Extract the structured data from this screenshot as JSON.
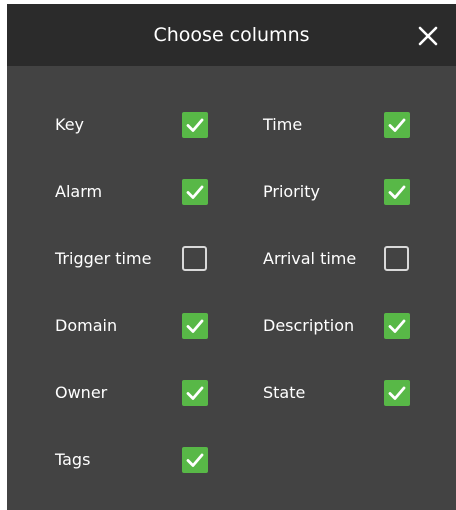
{
  "dialog": {
    "title": "Choose columns",
    "close_icon": "close-icon",
    "colors": {
      "background": "#434343",
      "titlebar": "#2b2b2b",
      "checked": "#58b847",
      "text": "#ffffff"
    }
  },
  "columns": [
    {
      "label": "Key",
      "checked": true
    },
    {
      "label": "Time",
      "checked": true
    },
    {
      "label": "Alarm",
      "checked": true
    },
    {
      "label": "Priority",
      "checked": true
    },
    {
      "label": "Trigger time",
      "checked": false
    },
    {
      "label": "Arrival time",
      "checked": false
    },
    {
      "label": "Domain",
      "checked": true
    },
    {
      "label": "Description",
      "checked": true
    },
    {
      "label": "Owner",
      "checked": true
    },
    {
      "label": "State",
      "checked": true
    },
    {
      "label": "Tags",
      "checked": true
    }
  ]
}
